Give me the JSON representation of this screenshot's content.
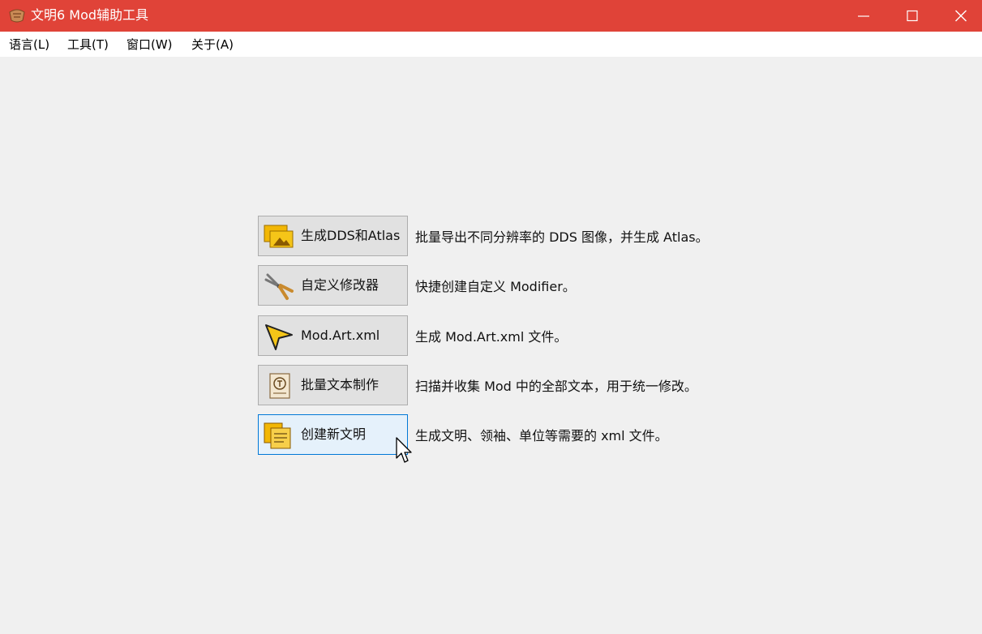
{
  "window": {
    "title": "文明6 Mod辅助工具",
    "accent_color": "#e04338",
    "controls": [
      "minimize-icon",
      "maximize-icon",
      "close-icon"
    ]
  },
  "menu": [
    {
      "label": "语言(L)"
    },
    {
      "label": "工具(T)"
    },
    {
      "label": "窗口(W)"
    },
    {
      "label": "关于(A)"
    }
  ],
  "actions": [
    {
      "label": "生成DDS和Atlas",
      "icon": "images-icon",
      "description": "批量导出不同分辨率的 DDS 图像，并生成 Atlas。"
    },
    {
      "label": "自定义修改器",
      "icon": "pliers-icon",
      "description": "快捷创建自定义 Modifier。"
    },
    {
      "label": "Mod.Art.xml",
      "icon": "paper-plane-icon",
      "description": "生成 Mod.Art.xml 文件。"
    },
    {
      "label": "批量文本制作",
      "icon": "text-document-icon",
      "description": "扫描并收集 Mod 中的全部文本，用于统一修改。"
    },
    {
      "label": "创建新文明",
      "icon": "documents-icon",
      "description": "生成文明、领袖、单位等需要的 xml 文件。",
      "state": "selected"
    }
  ]
}
